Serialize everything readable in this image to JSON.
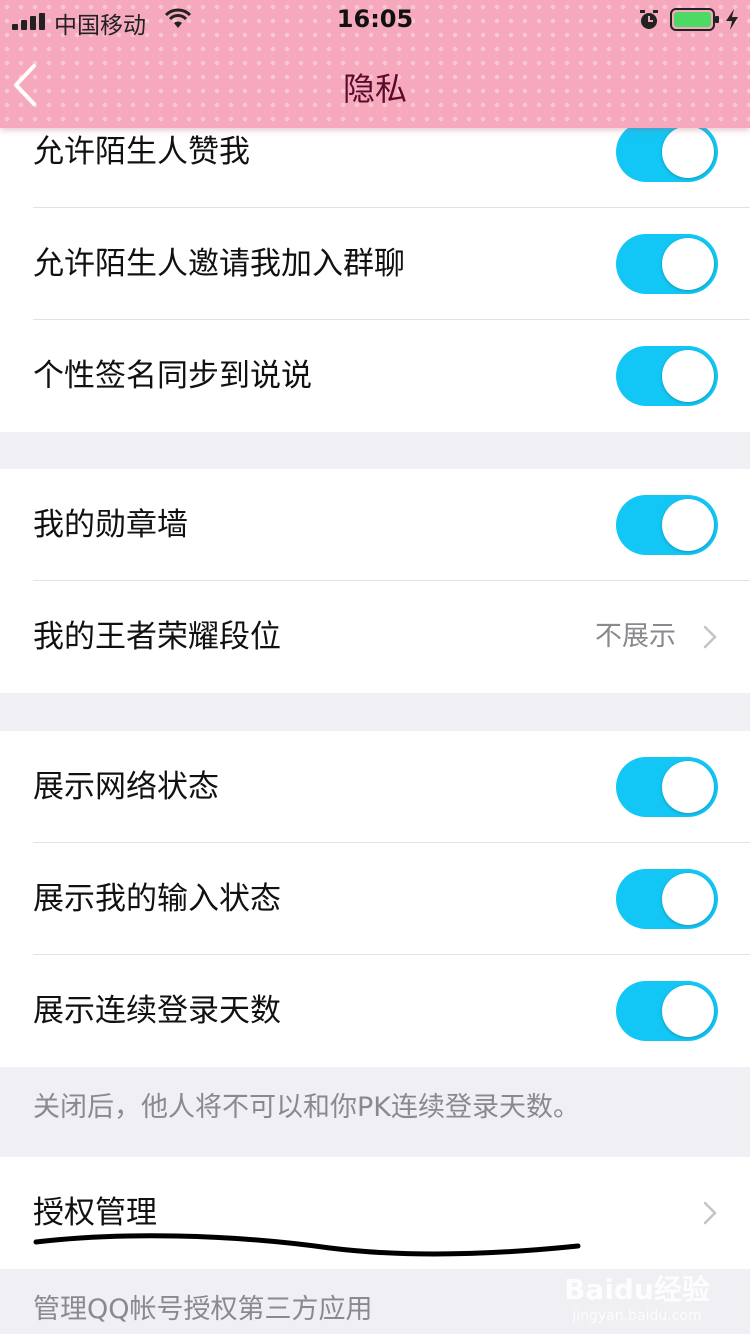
{
  "status_bar": {
    "carrier": "中国移动",
    "time": "16:05"
  },
  "nav": {
    "title": "隐私"
  },
  "groups": [
    {
      "rows": [
        {
          "label": "允许陌生人赞我",
          "toggle": true
        },
        {
          "label": "允许陌生人邀请我加入群聊",
          "toggle": true
        },
        {
          "label": "个性签名同步到说说",
          "toggle": true
        }
      ]
    },
    {
      "rows": [
        {
          "label": "我的勋章墙",
          "toggle": true
        },
        {
          "label": "我的王者荣耀段位",
          "value": "不展示"
        }
      ]
    },
    {
      "rows": [
        {
          "label": "展示网络状态",
          "toggle": true
        },
        {
          "label": "展示我的输入状态",
          "toggle": true
        },
        {
          "label": "展示连续登录天数",
          "toggle": true
        }
      ],
      "footer": "关闭后，他人将不可以和你PK连续登录天数。"
    },
    {
      "rows": [
        {
          "label": "授权管理"
        }
      ],
      "footer": "管理QQ帐号授权第三方应用"
    }
  ],
  "watermark": {
    "brand": "Baidu经验",
    "url": "jingyan.baidu.com"
  },
  "colors": {
    "header_pink": "#f6a9bd",
    "toggle_on": "#12c7f5",
    "title_text": "#5a0a2a"
  }
}
